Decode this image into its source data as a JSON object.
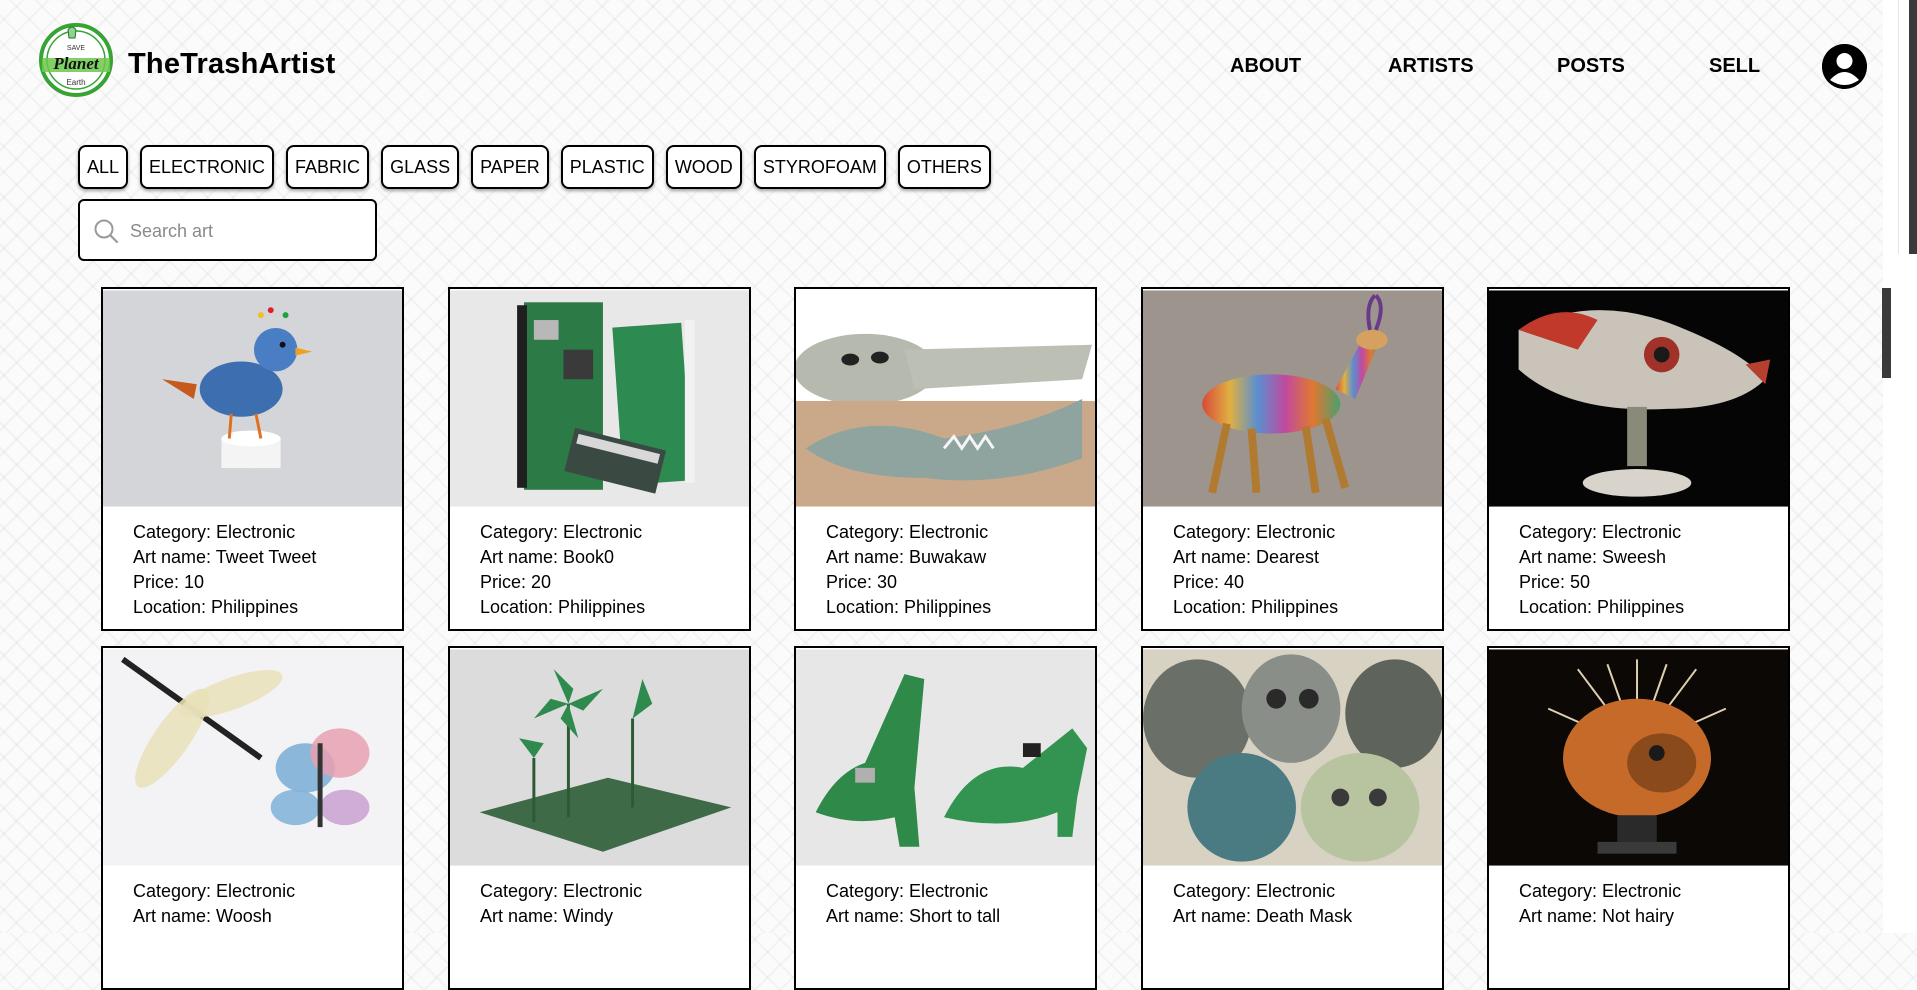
{
  "header": {
    "brand": "TheTrashArtist",
    "logo_text": [
      "SAVE",
      "Planet",
      "Earth"
    ],
    "nav": [
      "ABOUT",
      "ARTISTS",
      "POSTS",
      "SELL"
    ],
    "account_icon": "user-circle-icon"
  },
  "filters": [
    "ALL",
    "ELECTRONIC",
    "FABRIC",
    "GLASS",
    "PAPER",
    "PLASTIC",
    "WOOD",
    "STYROFOAM",
    "OTHERS"
  ],
  "search": {
    "placeholder": "Search art",
    "value": "",
    "icon": "search-icon"
  },
  "artworks": [
    {
      "category": "Category: Electronic",
      "name": "Art name: Tweet Tweet",
      "price": "Price: 10",
      "location": "Location: Philippines",
      "bg": "#d9d9dc",
      "subject": "bird"
    },
    {
      "category": "Category: Electronic",
      "name": "Art name: Book0",
      "price": "Price: 20",
      "location": "Location: Philippines",
      "bg": "#e9e9ea",
      "subject": "circuit-book"
    },
    {
      "category": "Category: Electronic",
      "name": "Art name: Buwakaw",
      "price": "Price: 30",
      "location": "Location: Philippines",
      "bg": "#ffffff",
      "subject": "mouse-animals"
    },
    {
      "category": "Category: Electronic",
      "name": "Art name: Dearest",
      "price": "Price: 40",
      "location": "Location: Philippines",
      "bg": "#a09890",
      "subject": "deer"
    },
    {
      "category": "Category: Electronic",
      "name": "Art name: Sweesh",
      "price": "Price: 50",
      "location": "Location: Philippines",
      "bg": "#050505",
      "subject": "fish"
    },
    {
      "category": "Category: Electronic",
      "name": "Art name: Woosh",
      "price": "",
      "location": "",
      "bg": "#f4f4f6",
      "subject": "dragonfly"
    },
    {
      "category": "Category: Electronic",
      "name": "Art name: Windy",
      "price": "",
      "location": "",
      "bg": "#dcdcdc",
      "subject": "windmill"
    },
    {
      "category": "Category: Electronic",
      "name": "Art name: Short to tall",
      "price": "",
      "location": "",
      "bg": "#e6e6e6",
      "subject": "shoes"
    },
    {
      "category": "Category: Electronic",
      "name": "Art name: Death Mask",
      "price": "",
      "location": "",
      "bg": "#d7d2c4",
      "subject": "masks"
    },
    {
      "category": "Category: Electronic",
      "name": "Art name: Not hairy",
      "price": "",
      "location": "",
      "bg": "#0c0806",
      "subject": "spiky-head"
    }
  ]
}
